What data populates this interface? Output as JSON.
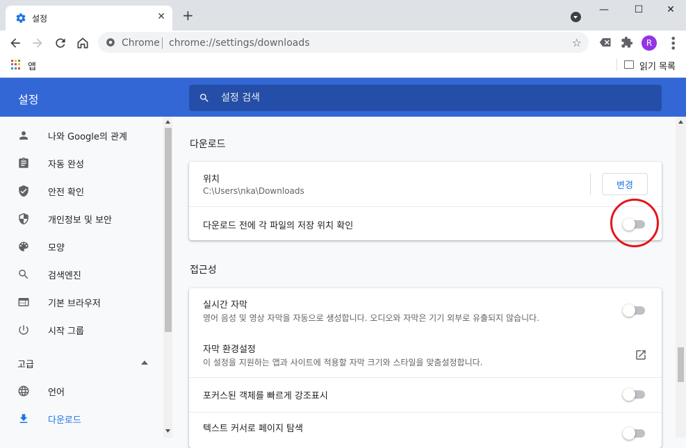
{
  "browser": {
    "tab_title": "설정",
    "tab_close": "✕",
    "new_tab": "+",
    "window_controls": [
      "—",
      "☐",
      "✕"
    ],
    "omnibox_site": "Chrome",
    "omnibox_url": "chrome://settings/downloads",
    "avatar_letter": "R",
    "bookmarks": {
      "apps_label": "앱",
      "reading_list_label": "읽기 목록"
    }
  },
  "header": {
    "title": "설정",
    "search_placeholder": "설정 검색"
  },
  "sidebar": {
    "items": [
      {
        "label": "나와 Google의 관계",
        "icon": "person-icon"
      },
      {
        "label": "자동 완성",
        "icon": "clipboard-icon"
      },
      {
        "label": "안전 확인",
        "icon": "shield-check-icon"
      },
      {
        "label": "개인정보 및 보안",
        "icon": "shield-icon"
      },
      {
        "label": "모양",
        "icon": "palette-icon"
      },
      {
        "label": "검색엔진",
        "icon": "search-icon"
      },
      {
        "label": "기본 브라우저",
        "icon": "browser-icon"
      },
      {
        "label": "시작 그룹",
        "icon": "power-icon"
      }
    ],
    "advanced_label": "고급",
    "advanced_items": [
      {
        "label": "언어",
        "icon": "globe-icon"
      },
      {
        "label": "다운로드",
        "icon": "download-icon",
        "active": true
      }
    ]
  },
  "downloads": {
    "section_title": "다운로드",
    "location_title": "위치",
    "location_path": "C:\\Users\\nka\\Downloads",
    "change_button": "변경",
    "ask_location_label": "다운로드 전에 각 파일의 저장 위치 확인",
    "ask_location_enabled": false
  },
  "accessibility": {
    "section_title": "접근성",
    "live_caption_title": "실시간 자막",
    "live_caption_desc": "영어 음성 및 영상 자막을 자동으로 생성합니다. 오디오와 자막은 기기 외부로 유출되지 않습니다.",
    "live_caption_enabled": false,
    "caption_prefs_title": "자막 환경설정",
    "caption_prefs_desc": "이 설정을 지원하는 앱과 사이트에 적용할 자막 크기와 스타일을 맞춤설정합니다.",
    "focus_highlight_label": "포커스된 객체를 빠르게 강조표시",
    "focus_highlight_enabled": false,
    "caret_browsing_title": "텍스트 커서로 페이지 탐색",
    "caret_browsing_enabled": false
  },
  "colors": {
    "accent": "#3367d6",
    "search_bg": "#254ea8",
    "highlight_circle": "#e5141a",
    "link": "#1a73e8"
  }
}
